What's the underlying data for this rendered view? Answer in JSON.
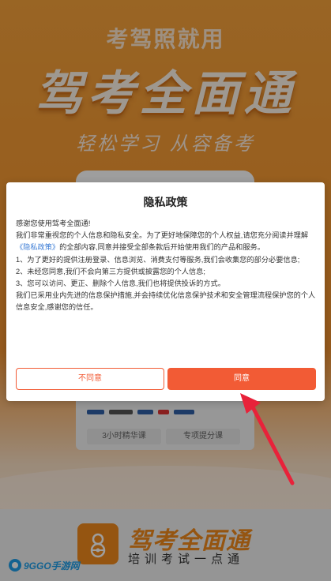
{
  "splash": {
    "slogan_top": "考驾照就用",
    "brand_big": "驾考全面通",
    "slogan_script": "轻松学习 从容备考",
    "chip_left": "3小时精华课",
    "chip_right": "专项提分课"
  },
  "dialog": {
    "title": "隐私政策",
    "greeting": "感谢您使用驾考全面通!",
    "para1_before": "我们非常重视您的个人信息和隐私安全。为了更好地保障您的个人权益,请您充分阅读并理解",
    "para1_link": "《隐私政策》",
    "para1_after": "的全部内容,同意并接受全部条款后开始使用我们的产品和服务。",
    "item1": "1、为了更好的提供注册登录、信息浏览、消费支付等服务,我们会收集您的部分必要信息;",
    "item2": "2、未经您同意,我们不会向第三方提供或披露您的个人信息;",
    "item3": "3、您可以访问、更正、删除个人信息,我们也将提供投诉的方式。",
    "closing": "我们已采用业内先进的信息保护措施,并会持续优化信息保护技术和安全管理流程保护您的个人信息安全,感谢您的信任。",
    "disagree_label": "不同意",
    "agree_label": "同意"
  },
  "bottom": {
    "brand_name": "驾考全面通",
    "tagline": "培训考试一点通",
    "watermark": "9GGO手游网"
  },
  "colors": {
    "accent": "#f25b35",
    "brand_orange": "#f08a1c",
    "annotation_red": "#e8223a"
  },
  "icons": [
    "driver-logo-icon",
    "watermark-logo-icon",
    "annotation-arrow-icon"
  ]
}
